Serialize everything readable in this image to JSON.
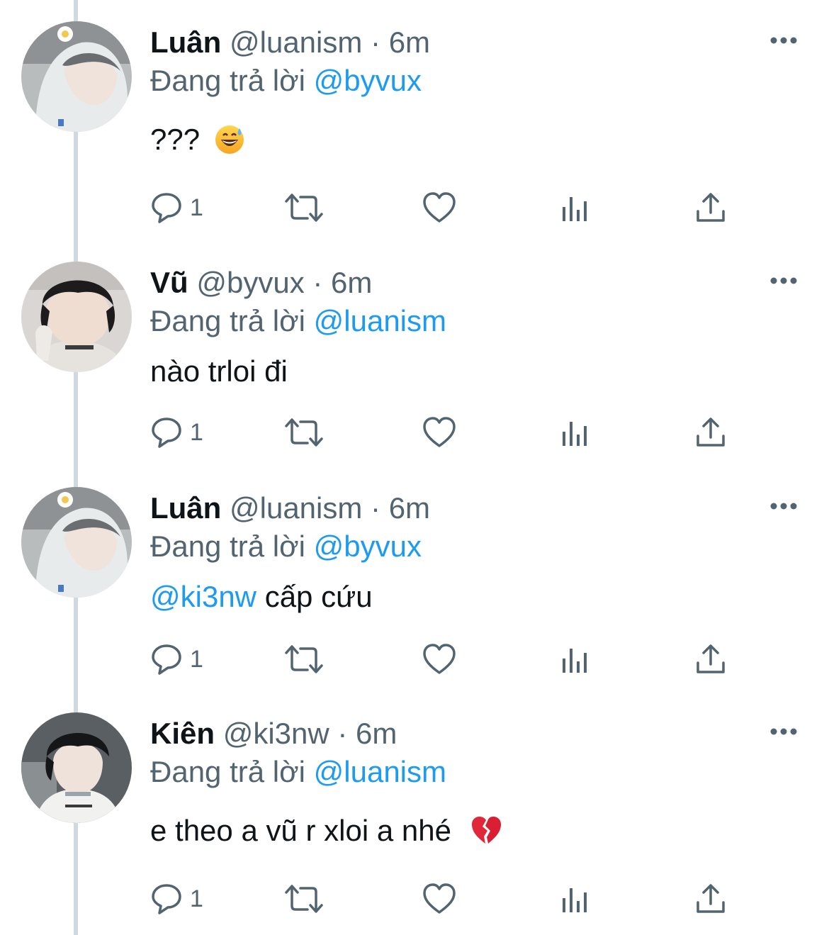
{
  "tweets": [
    {
      "name": "Luân",
      "handle": "@luanism",
      "separator": "·",
      "time": "6m",
      "replying_prefix": "Đang trả lời",
      "replying_to": "@byvux",
      "body_mention": "",
      "body_text": "???",
      "body_emoji": "grinning-face-with-sweat",
      "reply_count": "1",
      "avatar": "avatar-luan"
    },
    {
      "name": "Vũ",
      "handle": "@byvux",
      "separator": "·",
      "time": "6m",
      "replying_prefix": "Đang trả lời",
      "replying_to": "@luanism",
      "body_mention": "",
      "body_text": "nào trloi đi",
      "body_emoji": "",
      "reply_count": "1",
      "avatar": "avatar-vu"
    },
    {
      "name": "Luân",
      "handle": "@luanism",
      "separator": "·",
      "time": "6m",
      "replying_prefix": "Đang trả lời",
      "replying_to": "@byvux",
      "body_mention": "@ki3nw",
      "body_text": "cấp cứu",
      "body_emoji": "",
      "reply_count": "1",
      "avatar": "avatar-luan"
    },
    {
      "name": "Kiên",
      "handle": "@ki3nw",
      "separator": "·",
      "time": "6m",
      "replying_prefix": "Đang trả lời",
      "replying_to": "@luanism",
      "body_mention": "",
      "body_text": "e theo a vũ r xloi a nhé",
      "body_emoji": "broken-heart",
      "reply_count": "1",
      "avatar": "avatar-kien"
    }
  ],
  "icons": {
    "reply": "reply-icon",
    "retweet": "retweet-icon",
    "like": "like-icon",
    "views": "views-icon",
    "share": "share-icon",
    "more": "more-icon"
  },
  "colors": {
    "text": "#0f1419",
    "secondary": "#536471",
    "mention": "#1d9bf0",
    "thread_line": "#cfd9de",
    "background": "#ffffff"
  }
}
